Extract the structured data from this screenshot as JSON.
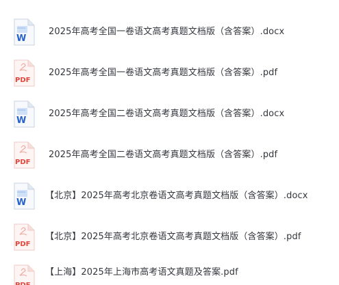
{
  "icons": {
    "word": "word-document-icon",
    "pdf": "pdf-document-icon"
  },
  "colors": {
    "word_accent": "#2a62c9",
    "word_light": "#cfe0f7",
    "pdf_accent": "#e0473d",
    "pdf_light": "#fbe1df",
    "text": "#33363c"
  },
  "icon_glyphs": {
    "word": "W",
    "pdf": "PDF"
  },
  "files": [
    {
      "type": "word",
      "name": "2025年高考全国一卷语文高考真题文档版（含答案）.docx"
    },
    {
      "type": "pdf",
      "name": "2025年高考全国一卷语文高考真题文档版（含答案）.pdf"
    },
    {
      "type": "word",
      "name": "2025年高考全国二卷语文高考真题文档版（含答案）.docx"
    },
    {
      "type": "pdf",
      "name": "2025年高考全国二卷语文高考真题文档版（含答案）.pdf"
    },
    {
      "type": "word",
      "name": "【北京】2025年高考北京卷语文高考真题文档版（含答案）.docx"
    },
    {
      "type": "pdf",
      "name": "【北京】2025年高考北京卷语文高考真题文档版（含答案）.pdf"
    },
    {
      "type": "pdf",
      "name": "【上海】2025年上海市高考语文真题及答案.pdf"
    }
  ]
}
